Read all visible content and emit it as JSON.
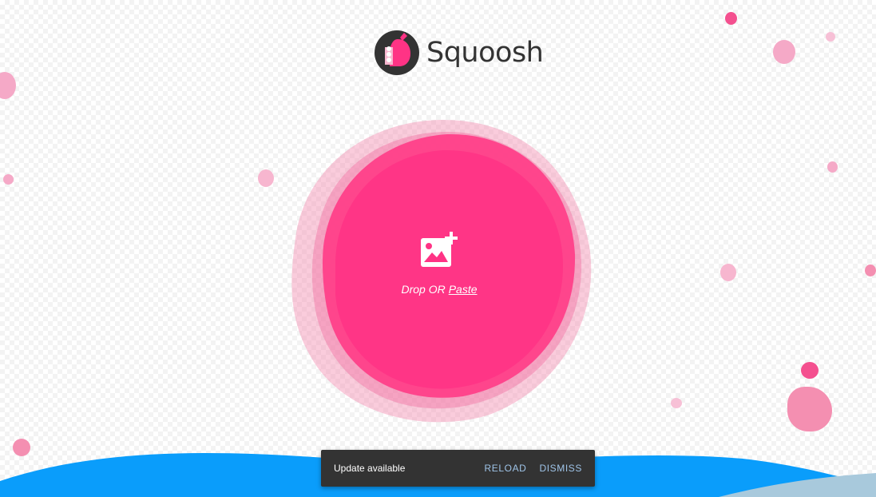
{
  "header": {
    "logo_text": "Squoosh",
    "logo_icon": "squoosh-hand-logo"
  },
  "drop_zone": {
    "icon": "add-image-icon",
    "drop_label": "Drop OR",
    "paste_label": "Paste"
  },
  "snackbar": {
    "message": "Update available",
    "reload_label": "RELOAD",
    "dismiss_label": "DISMISS"
  },
  "colors": {
    "brand_pink": "#ff3385",
    "blob_light": "#f48fb1",
    "wave_blue": "#0a9dfb",
    "snackbar_bg": "#333333",
    "snackbar_action": "#9fc4e8"
  }
}
